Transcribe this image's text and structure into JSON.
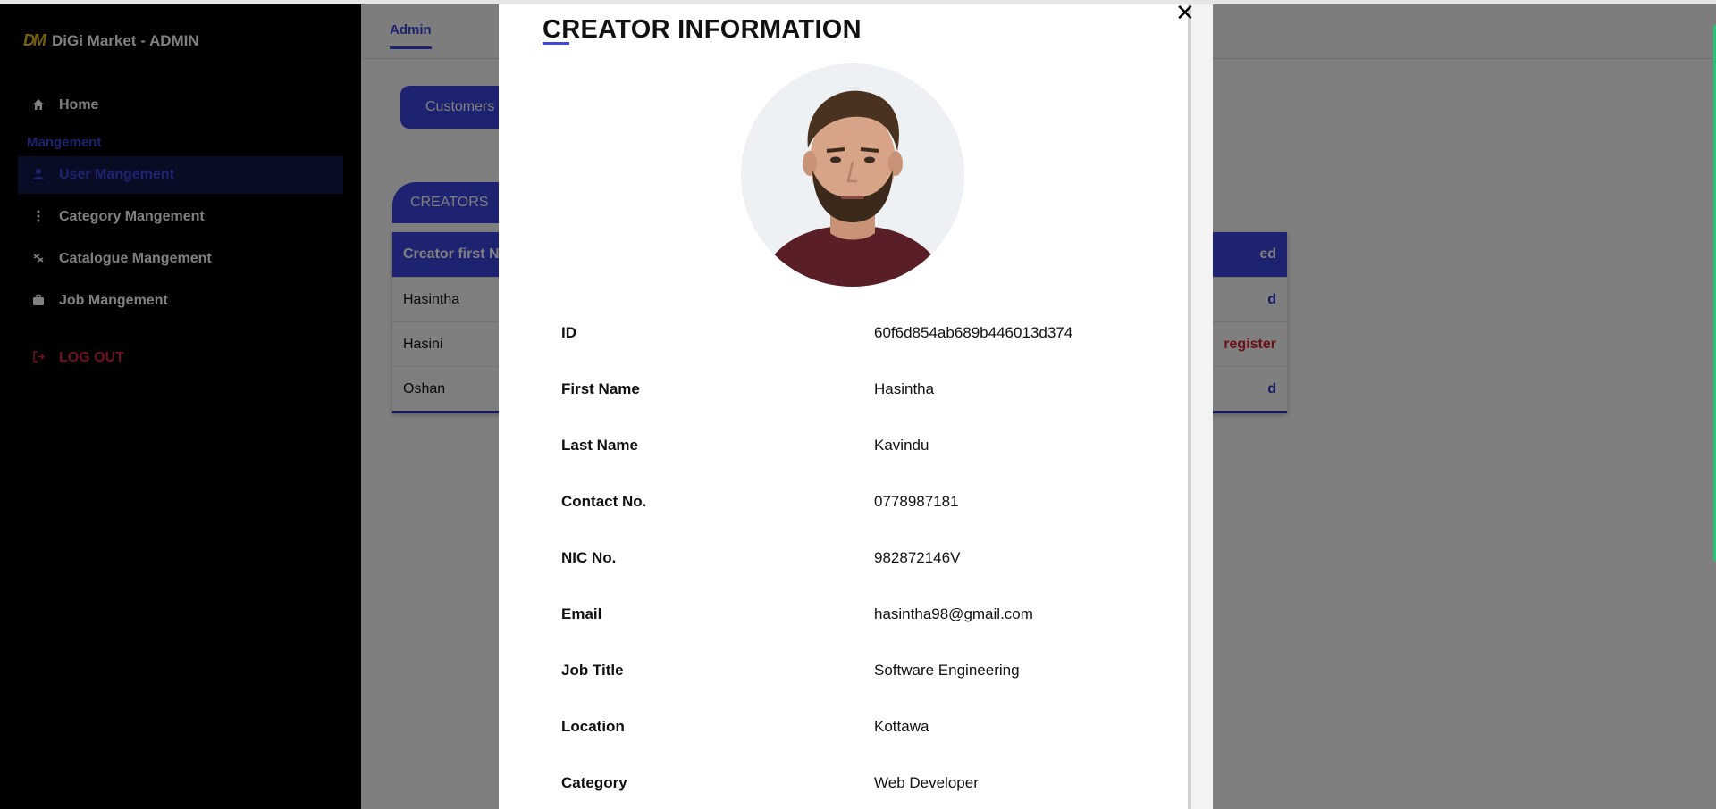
{
  "app": {
    "brand_logo": "DM",
    "brand_name": "DiGi Market - ADMIN"
  },
  "sidebar": {
    "home_label": "Home",
    "section_label": "Mangement",
    "items": [
      {
        "label": "User Mangement",
        "icon": "user-icon",
        "active": true
      },
      {
        "label": "Category Mangement",
        "icon": "dots-vertical-icon",
        "active": false
      },
      {
        "label": "Catalogue Mangement",
        "icon": "catalogue-icon",
        "active": false
      },
      {
        "label": "Job Mangement",
        "icon": "briefcase-icon",
        "active": false
      }
    ],
    "logout_label": "LOG OUT"
  },
  "main": {
    "top_tab": "Admin",
    "pill_button": "Customers",
    "section_tab": "CREATORS",
    "table": {
      "header_left": "Creator first N",
      "header_right": "ed",
      "rows": [
        {
          "name": "Hasintha",
          "status": "d",
          "status_color": "#2a33c0"
        },
        {
          "name": "Hasini",
          "status": "register",
          "status_color": "#d81e2e"
        },
        {
          "name": "Oshan",
          "status": "d",
          "status_color": "#2a33c0"
        }
      ]
    }
  },
  "modal": {
    "title": "CREATOR INFORMATION",
    "close_icon": "close-icon",
    "fields": [
      {
        "label": "ID",
        "value": "60f6d854ab689b446013d374"
      },
      {
        "label": "First Name",
        "value": "Hasintha"
      },
      {
        "label": "Last Name",
        "value": "Kavindu"
      },
      {
        "label": "Contact No.",
        "value": "0778987181"
      },
      {
        "label": "NIC No.",
        "value": "982872146V"
      },
      {
        "label": "Email",
        "value": "hasintha98@gmail.com"
      },
      {
        "label": "Job Title",
        "value": "Software Engineering"
      },
      {
        "label": "Location",
        "value": "Kottawa"
      },
      {
        "label": "Category",
        "value": "Web Developer"
      }
    ]
  },
  "colors": {
    "accent": "#3a47e0",
    "sidebar_bg": "#000000",
    "danger": "#d81e2e"
  }
}
